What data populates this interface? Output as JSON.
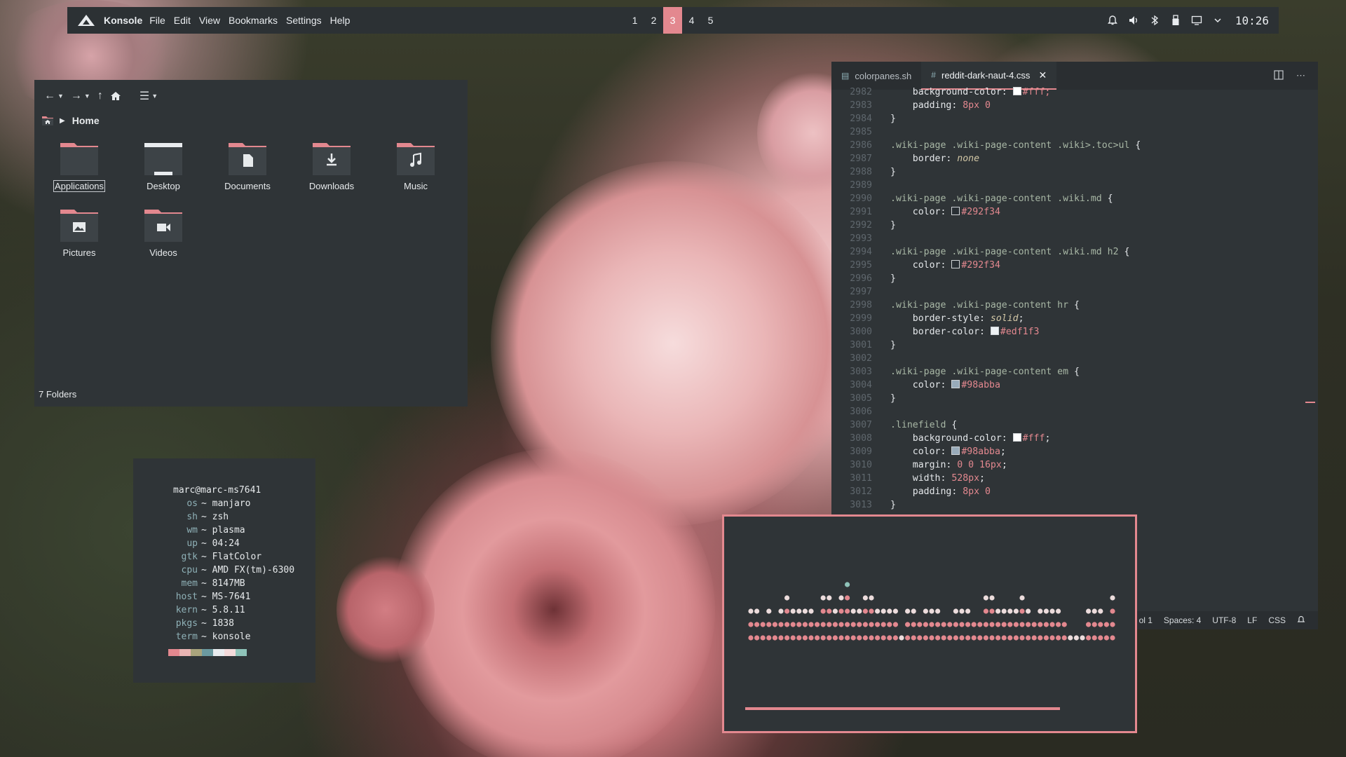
{
  "panel": {
    "app_name": "Konsole",
    "menus": [
      "File",
      "Edit",
      "View",
      "Bookmarks",
      "Settings",
      "Help"
    ],
    "desktops": [
      "1",
      "2",
      "3",
      "4",
      "5"
    ],
    "active_desktop": "3",
    "tray_icons": [
      "alarm-icon",
      "volume-icon",
      "bluetooth-icon",
      "usb-icon",
      "display-icon",
      "chevron-down-icon"
    ],
    "clock": "10:26"
  },
  "file_manager": {
    "breadcrumb": "Home",
    "folders": [
      {
        "label": "Applications",
        "icon": "applications-folder-icon",
        "selected": true
      },
      {
        "label": "Desktop",
        "icon": "desktop-folder-icon"
      },
      {
        "label": "Documents",
        "icon": "documents-folder-icon"
      },
      {
        "label": "Downloads",
        "icon": "downloads-folder-icon"
      },
      {
        "label": "Music",
        "icon": "music-folder-icon"
      },
      {
        "label": "Pictures",
        "icon": "pictures-folder-icon"
      },
      {
        "label": "Videos",
        "icon": "videos-folder-icon"
      }
    ],
    "status": "7 Folders"
  },
  "fetch": {
    "user": "marc@marc-ms7641",
    "rows": [
      {
        "key": "os",
        "value": "~ manjaro"
      },
      {
        "key": "sh",
        "value": "~ zsh"
      },
      {
        "key": "wm",
        "value": "~ plasma"
      },
      {
        "key": "up",
        "value": "~ 04:24"
      },
      {
        "key": "gtk",
        "value": "~ FlatColor"
      },
      {
        "key": "cpu",
        "value": "~ AMD FX(tm)-6300"
      },
      {
        "key": "mem",
        "value": "~ 8147MB"
      },
      {
        "key": "host",
        "value": "~ MS-7641"
      },
      {
        "key": "kern",
        "value": "~ 5.8.11"
      },
      {
        "key": "pkgs",
        "value": "~ 1838"
      },
      {
        "key": "term",
        "value": "~ konsole"
      }
    ],
    "palette": [
      "#e3888f",
      "#e9b4b3",
      "#a9a47c",
      "#6b9aa0",
      "#e9ecef",
      "#f4dada",
      "#8fc3b9"
    ]
  },
  "editor": {
    "tabs": [
      {
        "label": "colorpanes.sh",
        "icon": "file-icon",
        "active": false
      },
      {
        "label": "reddit-dark-naut-4.css",
        "icon": "hash-icon",
        "active": true
      }
    ],
    "lines": [
      {
        "n": "2982",
        "parts": [
          [
            "prop",
            "    background-color: "
          ],
          [
            "swatch",
            "#ffffff"
          ],
          [
            "val",
            "#fff;"
          ]
        ]
      },
      {
        "n": "2983",
        "parts": [
          [
            "prop",
            "    padding: "
          ],
          [
            "val",
            "8px 0"
          ]
        ]
      },
      {
        "n": "2984",
        "parts": [
          [
            "br",
            "}"
          ]
        ]
      },
      {
        "n": "2985",
        "parts": []
      },
      {
        "n": "2986",
        "parts": [
          [
            "sel",
            ".wiki-page .wiki-page-content .wiki>.toc>ul "
          ],
          [
            "br",
            "{"
          ]
        ]
      },
      {
        "n": "2987",
        "parts": [
          [
            "prop",
            "    border: "
          ],
          [
            "kw",
            "none"
          ]
        ]
      },
      {
        "n": "2988",
        "parts": [
          [
            "br",
            "}"
          ]
        ]
      },
      {
        "n": "2989",
        "parts": []
      },
      {
        "n": "2990",
        "parts": [
          [
            "sel",
            ".wiki-page .wiki-page-content .wiki.md "
          ],
          [
            "br",
            "{"
          ]
        ]
      },
      {
        "n": "2991",
        "parts": [
          [
            "prop",
            "    color: "
          ],
          [
            "swatch",
            "#292f34"
          ],
          [
            "val",
            "#292f34"
          ]
        ]
      },
      {
        "n": "2992",
        "parts": [
          [
            "br",
            "}"
          ]
        ]
      },
      {
        "n": "2993",
        "parts": []
      },
      {
        "n": "2994",
        "parts": [
          [
            "sel",
            ".wiki-page .wiki-page-content .wiki.md h2 "
          ],
          [
            "br",
            "{"
          ]
        ]
      },
      {
        "n": "2995",
        "parts": [
          [
            "prop",
            "    color: "
          ],
          [
            "swatch",
            "#292f34"
          ],
          [
            "val",
            "#292f34"
          ]
        ]
      },
      {
        "n": "2996",
        "parts": [
          [
            "br",
            "}"
          ]
        ]
      },
      {
        "n": "2997",
        "parts": []
      },
      {
        "n": "2998",
        "parts": [
          [
            "sel",
            ".wiki-page .wiki-page-content hr "
          ],
          [
            "br",
            "{"
          ]
        ]
      },
      {
        "n": "2999",
        "parts": [
          [
            "prop",
            "    border-style: "
          ],
          [
            "kw",
            "solid"
          ],
          [
            "prop",
            ";"
          ]
        ]
      },
      {
        "n": "3000",
        "parts": [
          [
            "prop",
            "    border-color: "
          ],
          [
            "swatch",
            "#edf1f3"
          ],
          [
            "val",
            "#edf1f3"
          ]
        ]
      },
      {
        "n": "3001",
        "parts": [
          [
            "br",
            "}"
          ]
        ]
      },
      {
        "n": "3002",
        "parts": []
      },
      {
        "n": "3003",
        "parts": [
          [
            "sel",
            ".wiki-page .wiki-page-content em "
          ],
          [
            "br",
            "{"
          ]
        ]
      },
      {
        "n": "3004",
        "parts": [
          [
            "prop",
            "    color: "
          ],
          [
            "swatch",
            "#98abba"
          ],
          [
            "val",
            "#98abba"
          ]
        ]
      },
      {
        "n": "3005",
        "parts": [
          [
            "br",
            "}"
          ]
        ]
      },
      {
        "n": "3006",
        "parts": []
      },
      {
        "n": "3007",
        "parts": [
          [
            "sel",
            ".linefield "
          ],
          [
            "br",
            "{"
          ]
        ]
      },
      {
        "n": "3008",
        "parts": [
          [
            "prop",
            "    background-color: "
          ],
          [
            "swatch",
            "#ffffff"
          ],
          [
            "val",
            "#fff"
          ],
          [
            "prop",
            ";"
          ]
        ]
      },
      {
        "n": "3009",
        "parts": [
          [
            "prop",
            "    color: "
          ],
          [
            "swatch",
            "#98abba"
          ],
          [
            "val",
            "#98abba"
          ],
          [
            "prop",
            ";"
          ]
        ]
      },
      {
        "n": "3010",
        "parts": [
          [
            "prop",
            "    margin: "
          ],
          [
            "val",
            "0 0 16px"
          ],
          [
            "prop",
            ";"
          ]
        ]
      },
      {
        "n": "3011",
        "parts": [
          [
            "prop",
            "    width: "
          ],
          [
            "val",
            "528px"
          ],
          [
            "prop",
            ";"
          ]
        ]
      },
      {
        "n": "3012",
        "parts": [
          [
            "prop",
            "    padding: "
          ],
          [
            "val",
            "8px 0"
          ]
        ]
      },
      {
        "n": "3013",
        "parts": [
          [
            "br",
            "}"
          ]
        ]
      }
    ],
    "status": {
      "col": "ol 1",
      "spaces": "Spaces: 4",
      "encoding": "UTF-8",
      "eol": "LF",
      "language": "CSS"
    }
  },
  "visualizer": {
    "colors": {
      "low": "#e3888f",
      "mid": "#ecdcdc",
      "peak": "#8fc3b9"
    },
    "columns": [
      3,
      3,
      2,
      3,
      2,
      3,
      4,
      3,
      3,
      3,
      3,
      2,
      4,
      4,
      3,
      4,
      5,
      3,
      3,
      4,
      4,
      3,
      3,
      3,
      3,
      1,
      3,
      3,
      2,
      3,
      3,
      3,
      2,
      2,
      3,
      3,
      3,
      2,
      2,
      4,
      4,
      3,
      3,
      3,
      3,
      4,
      3,
      2,
      3,
      3,
      3,
      3,
      2,
      1,
      1,
      1,
      3,
      3,
      3,
      2,
      4
    ]
  }
}
